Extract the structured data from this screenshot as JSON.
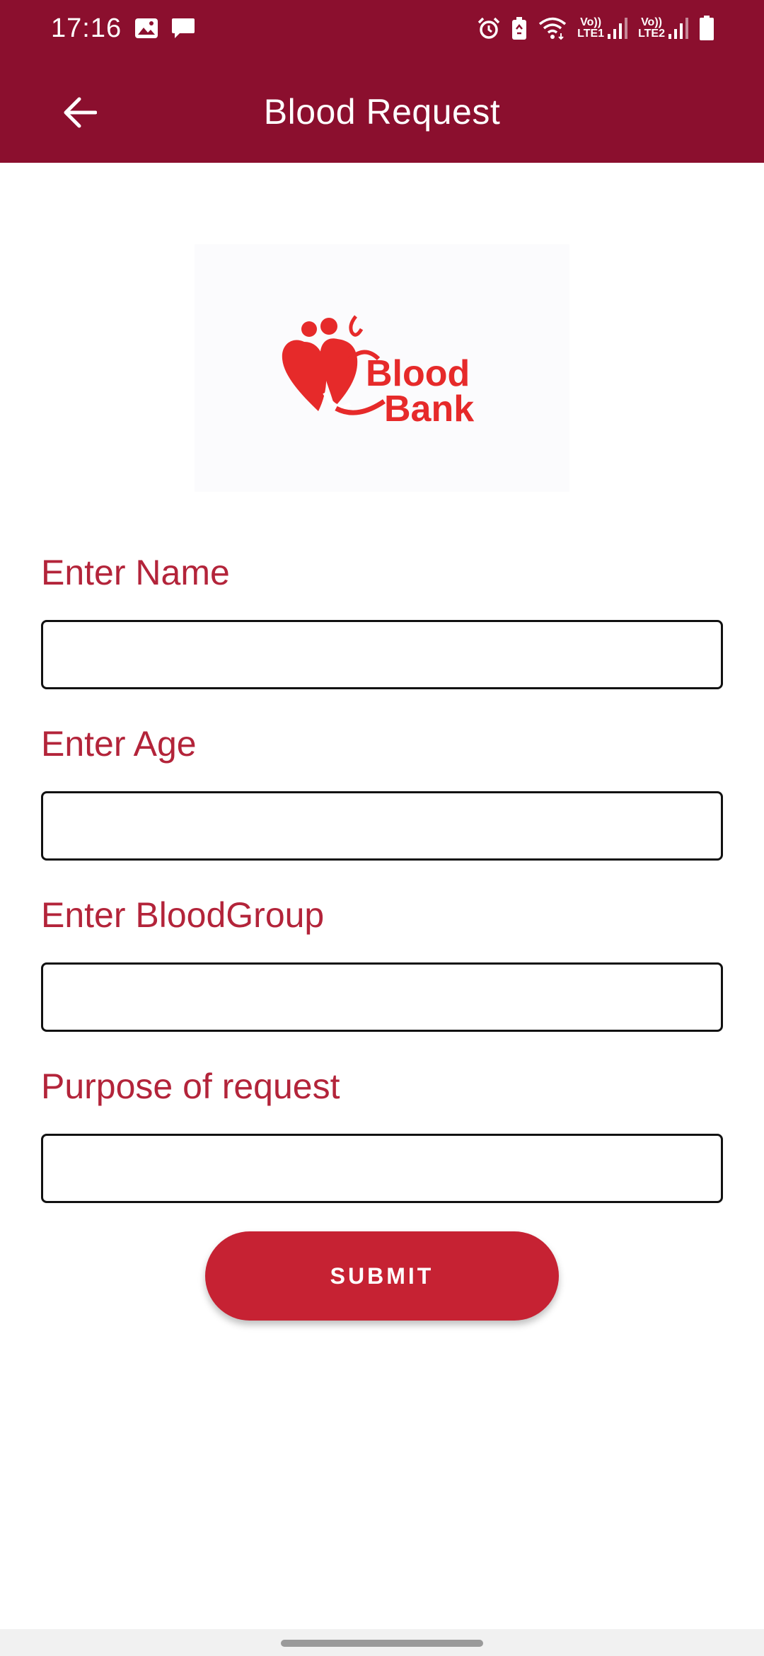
{
  "status_bar": {
    "time": "17:16",
    "sim1": {
      "top": "Vo))",
      "bottom": "LTE1"
    },
    "sim2": {
      "top": "Vo))",
      "bottom": "LTE2"
    }
  },
  "toolbar": {
    "title": "Blood Request",
    "back_icon": "arrow-left-icon"
  },
  "logo": {
    "line1": "Blood",
    "line2": "Bank"
  },
  "form": {
    "fields": [
      {
        "label": "Enter Name",
        "value": ""
      },
      {
        "label": "Enter Age",
        "value": ""
      },
      {
        "label": "Enter BloodGroup",
        "value": ""
      },
      {
        "label": "Purpose of request",
        "value": ""
      }
    ],
    "submit_label": "SUBMIT"
  },
  "colors": {
    "appbar": "#8b0f2e",
    "label": "#b3243a",
    "button": "#c62233",
    "logo": "#e62a2a"
  }
}
